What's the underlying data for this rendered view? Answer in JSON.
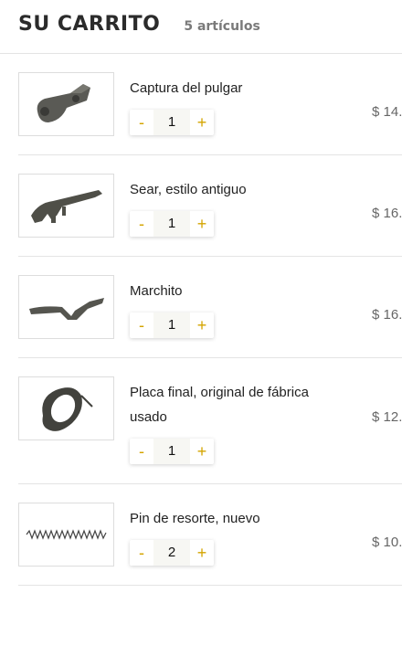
{
  "cart": {
    "title": "SU CARRITO",
    "count_label": "5 artículos"
  },
  "items": [
    {
      "name": "Captura del pulgar",
      "quantity": "1",
      "price": "$ 14.",
      "minus": "-",
      "plus": "+"
    },
    {
      "name": "Sear, estilo antiguo",
      "quantity": "1",
      "price": "$ 16.",
      "minus": "-",
      "plus": "+"
    },
    {
      "name": "Marchito",
      "quantity": "1",
      "price": "$ 16.",
      "minus": "-",
      "plus": "+"
    },
    {
      "name": "Placa final, original de fábrica usado",
      "quantity": "1",
      "price": "$ 12.",
      "minus": "-",
      "plus": "+"
    },
    {
      "name": "Pin de resorte, nuevo",
      "quantity": "2",
      "price": "$ 10.",
      "minus": "-",
      "plus": "+"
    }
  ]
}
